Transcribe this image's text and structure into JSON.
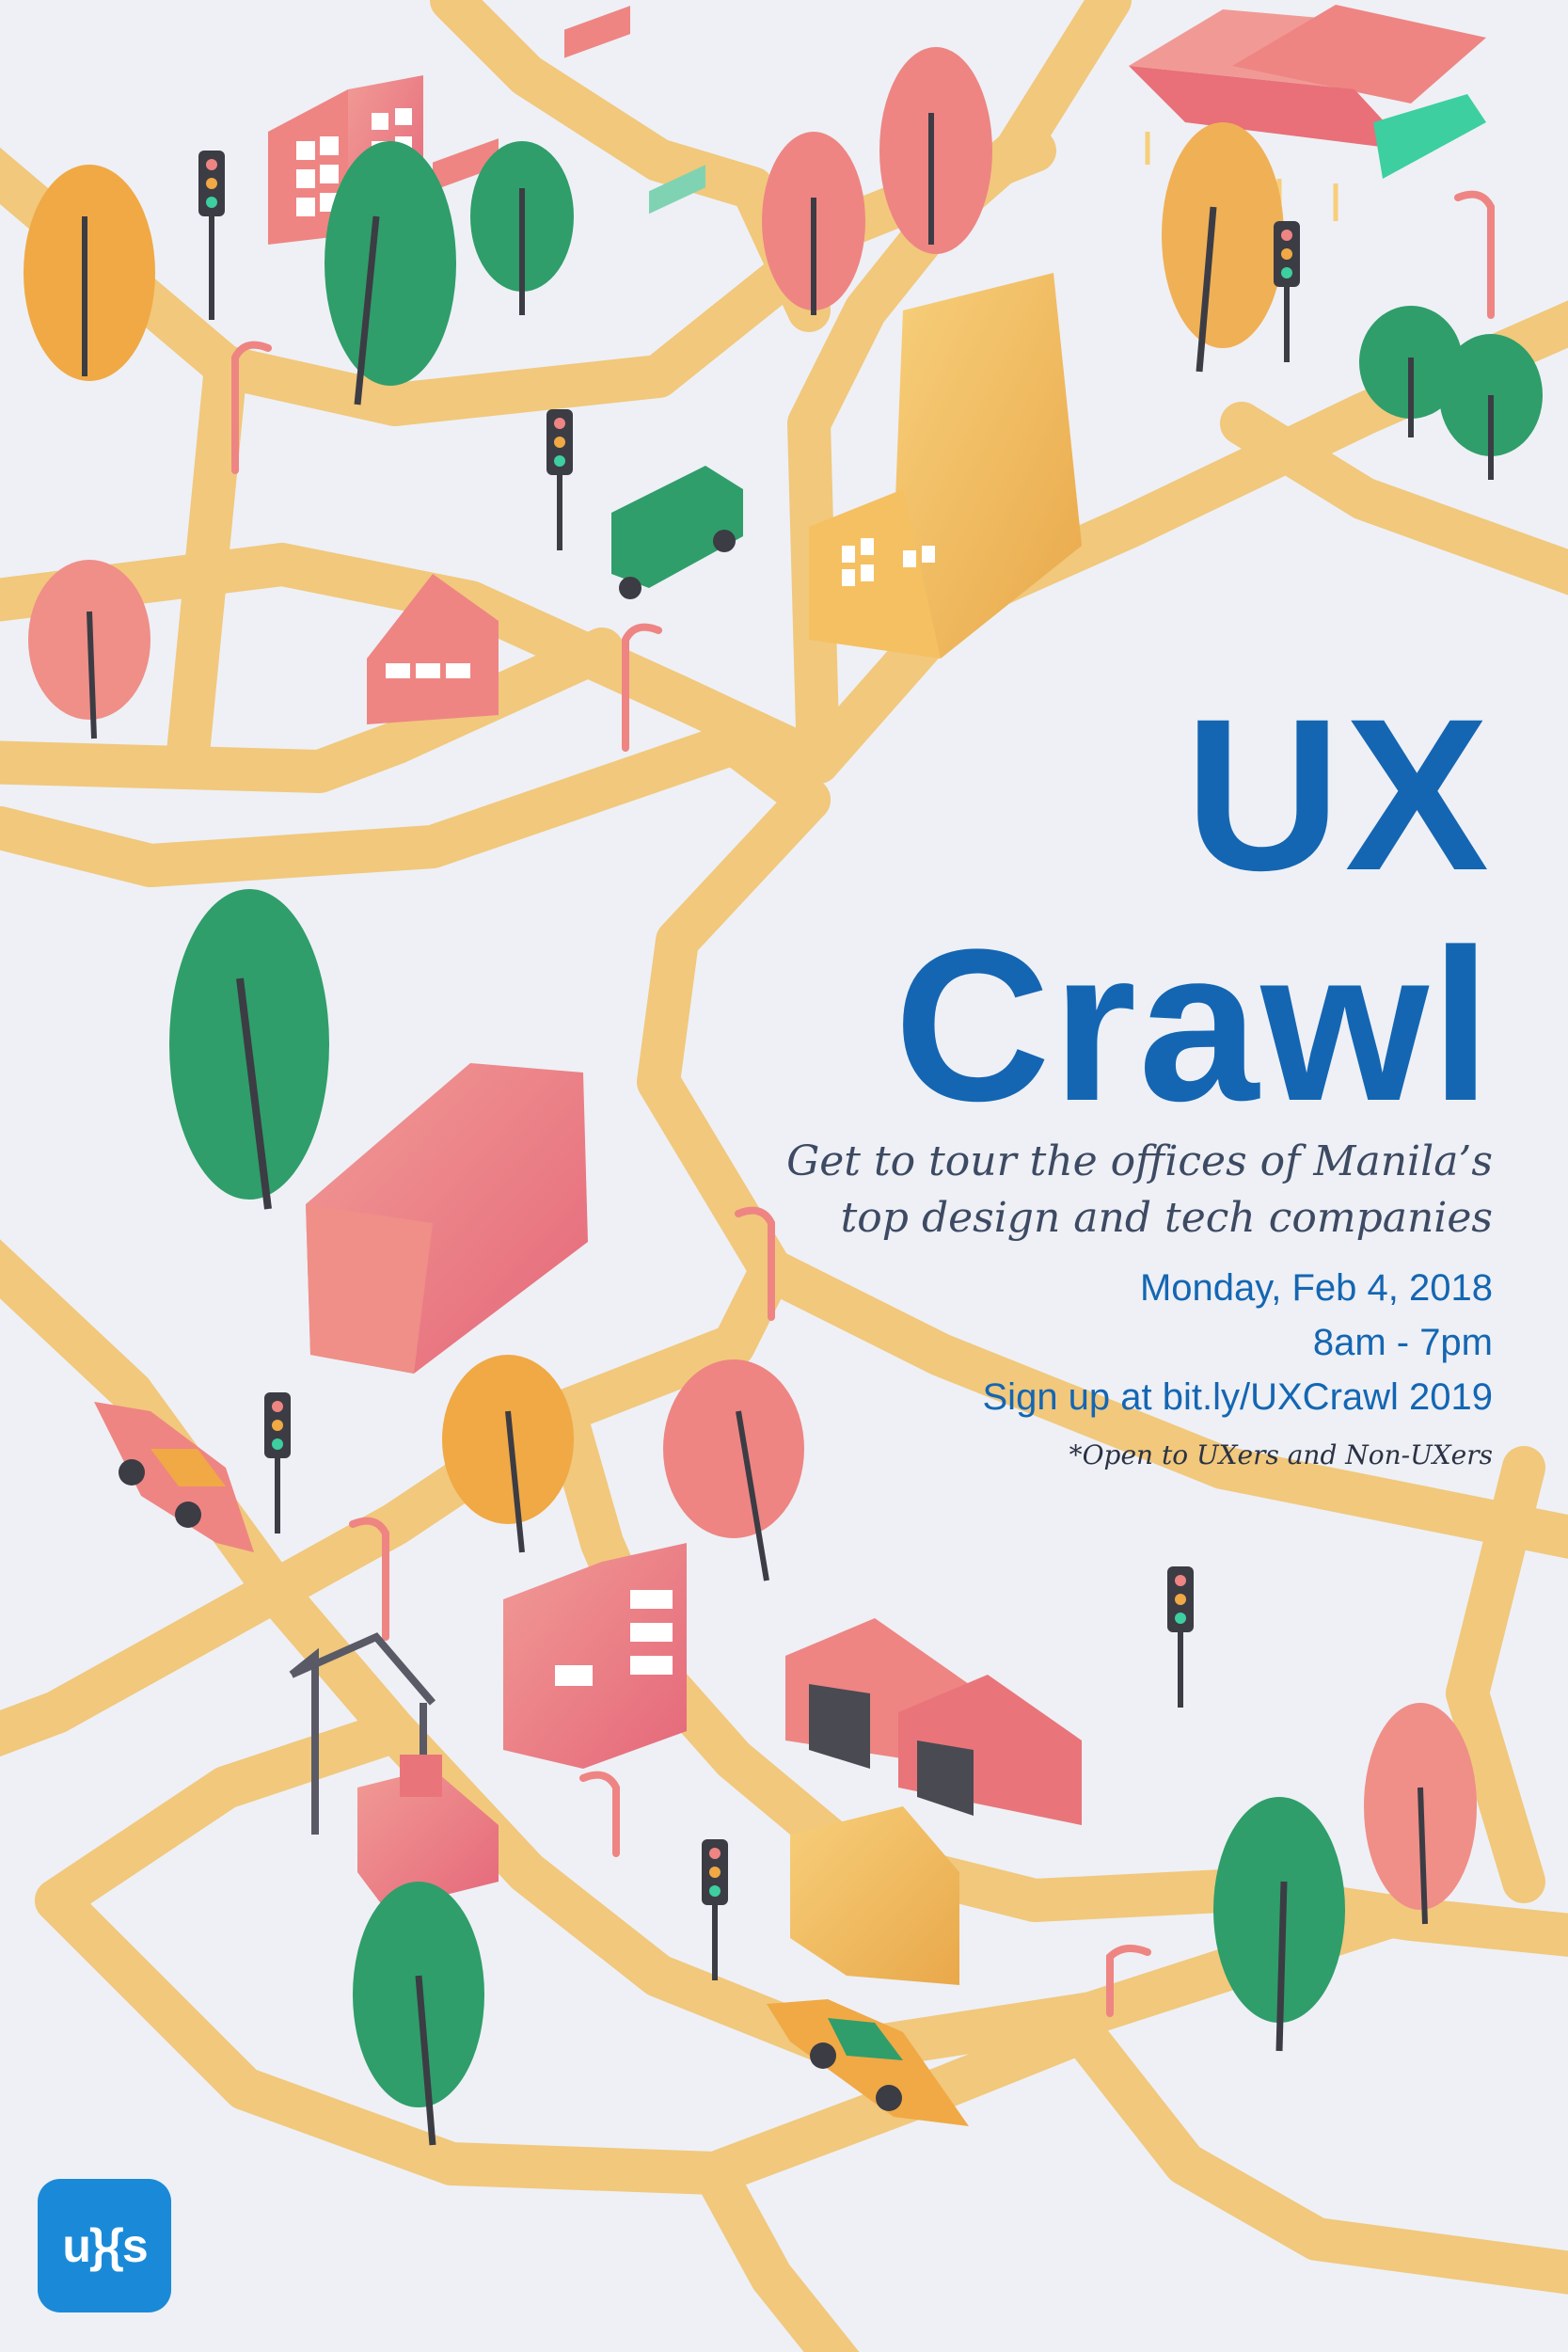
{
  "poster": {
    "title_line_1": "UX",
    "title_line_2": "Crawl",
    "tagline_line_1": "Get to tour the offices of Manila’s",
    "tagline_line_2": "top design and tech companies",
    "date": "Monday, Feb 4, 2018",
    "time": "8am - 7pm",
    "signup": "Sign up at bit.ly/UXCrawl 2019",
    "note": "*Open to UXers and Non-UXers",
    "logo_text": "u}{s"
  },
  "colors": {
    "background": "#eef0f5",
    "road": "#f1c87c",
    "title_blue": "#1466b3",
    "logo_blue": "#1a8ad8",
    "pink": "#ee8583",
    "green": "#2f9e6a",
    "orange": "#f0a945"
  },
  "icons": [
    "tree-icon",
    "building-icon",
    "house-icon",
    "traffic-light-icon",
    "street-lamp-icon",
    "car-icon",
    "bus-icon",
    "crane-icon",
    "bench-icon",
    "tent-icon"
  ]
}
